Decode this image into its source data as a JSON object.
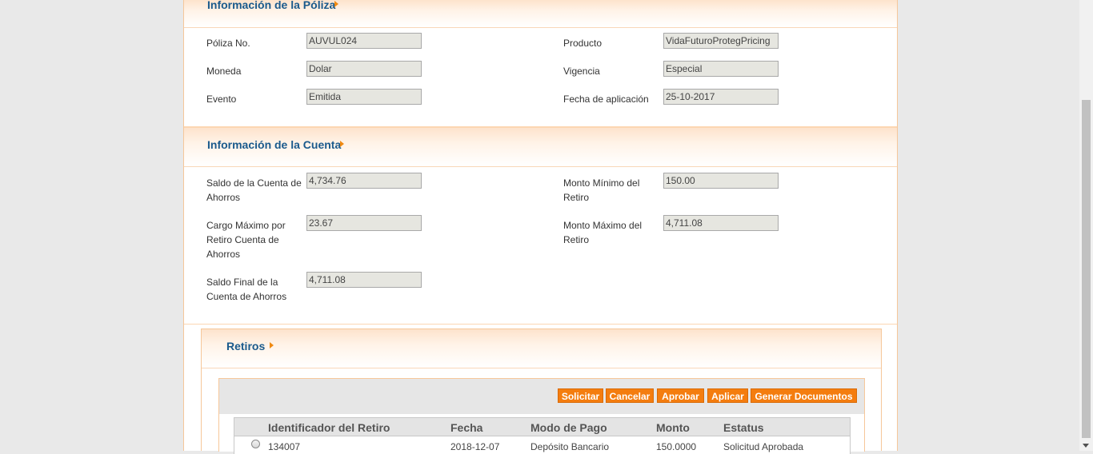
{
  "poliza": {
    "title": "Información de la Póliza",
    "poliza_no_label": "Póliza No.",
    "poliza_no_value": "AUVUL024",
    "producto_label": "Producto",
    "producto_value": "VidaFuturoProtegPricing",
    "moneda_label": "Moneda",
    "moneda_value": "Dolar",
    "vigencia_label": "Vigencia",
    "vigencia_value": "Especial",
    "evento_label": "Evento",
    "evento_value": "Emitida",
    "fecha_aplicacion_label": "Fecha de aplicación",
    "fecha_aplicacion_value": "25-10-2017"
  },
  "cuenta": {
    "title": "Información de la Cuenta",
    "saldo_cuenta_label_1": "Saldo de la Cuenta de",
    "saldo_cuenta_label_2": "Ahorros",
    "saldo_cuenta_value": "4,734.76",
    "monto_minimo_label_1": "Monto Mínimo del",
    "monto_minimo_label_2": "Retiro",
    "monto_minimo_value": "150.00",
    "cargo_maximo_label_1": "Cargo Máximo por",
    "cargo_maximo_label_2": "Retiro Cuenta de",
    "cargo_maximo_label_3": "Ahorros",
    "cargo_maximo_value": "23.67",
    "monto_maximo_label_1": "Monto Máximo del",
    "monto_maximo_label_2": "Retiro",
    "monto_maximo_value": "4,711.08",
    "saldo_final_label_1": "Saldo Final de la",
    "saldo_final_label_2": "Cuenta de Ahorros",
    "saldo_final_value": "4,711.08"
  },
  "retiros": {
    "title": "Retiros",
    "buttons": {
      "solicitar": "Solicitar",
      "cancelar": "Cancelar",
      "aprobar": "Aprobar",
      "aplicar": "Aplicar",
      "generar": "Generar Documentos"
    },
    "columns": {
      "identificador": "Identificador del Retiro",
      "fecha": "Fecha",
      "modo_pago": "Modo de Pago",
      "monto": "Monto",
      "estatus": "Estatus"
    },
    "rows": [
      {
        "identificador": "134007",
        "fecha": "2018-12-07",
        "modo_pago": "Depósito Bancario",
        "monto": "150.0000",
        "estatus": "Solicitud Aprobada"
      }
    ]
  },
  "colors": {
    "accent_orange": "#f47d0f",
    "title_blue": "#1a5a8c",
    "border_orange": "#f6c79a"
  },
  "icons": [
    "caret-right-icon",
    "radio-icon",
    "scroll-down-arrow-icon"
  ]
}
